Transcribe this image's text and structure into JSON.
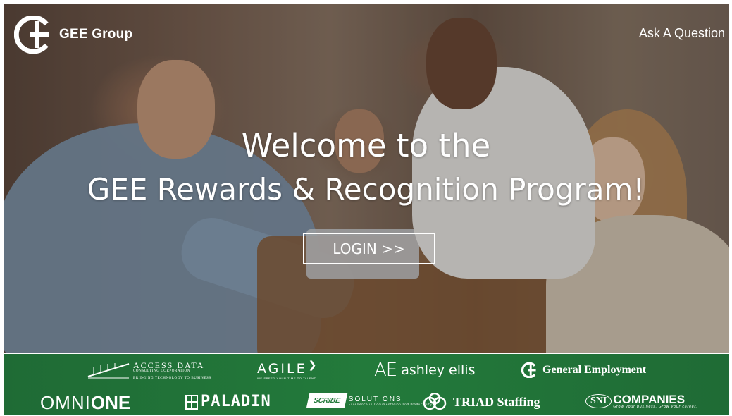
{
  "header": {
    "logo_text": "GEE Group",
    "ask_link": "Ask A Question"
  },
  "hero": {
    "line1": "Welcome to the",
    "line2": "GEE Rewards & Recognition Program!",
    "login_label": "LOGIN >>"
  },
  "brands": {
    "access_data": {
      "name": "ACCESS DATA",
      "sub": "CONSULTING CORPORATION",
      "tagline": "BRIDGING TECHNOLOGY TO BUSINESS"
    },
    "agile": {
      "name": "AGILE",
      "tagline": "WE SPEED YOUR TIME TO TALENT"
    },
    "ashley_ellis": {
      "mark": "AE",
      "name": "ashley ellis"
    },
    "general_employment": {
      "name": "General Employment"
    },
    "omnione": {
      "part1": "OMNI",
      "part2": "ONE"
    },
    "paladin": {
      "name": "PALADIN"
    },
    "scribe": {
      "part1": "SCRIBE",
      "part2": "SOLUTIONS",
      "tagline": "Excellence in Documentation and Productivity"
    },
    "triad": {
      "name": "TRIAD Staffing"
    },
    "sni": {
      "mark": "SNI",
      "name": "COMPANIES",
      "tagline": "Grow your business. Grow your career."
    }
  },
  "colors": {
    "strip_green": "#237a3b",
    "text": "#ffffff"
  },
  "icons": [
    "gee-logo-icon",
    "agile-chevron-icon",
    "paladin-tower-icon",
    "triad-clover-icon"
  ]
}
